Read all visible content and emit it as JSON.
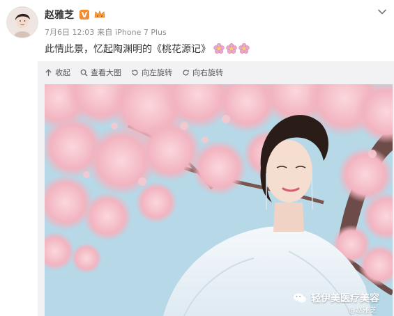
{
  "user": {
    "name": "赵雅芝",
    "verified_mark": "V"
  },
  "meta": {
    "date": "7月6日 12:03",
    "source_prefix": "来自",
    "device": "iPhone 7 Plus"
  },
  "post": {
    "text": "此情此景，忆起陶渊明的《桃花源记》",
    "emoji": [
      "flower",
      "flower",
      "flower"
    ]
  },
  "toolbar": {
    "collapse": "收起",
    "view_large": "查看大图",
    "rotate_left": "向左旋转",
    "rotate_right": "向右旋转"
  },
  "watermark": {
    "brand": "轻伊美医疗美容",
    "handle": "@赵雅芝"
  },
  "colors": {
    "badge": "#f28a2e",
    "meta_text": "#8b8b8b",
    "media_bg": "#f2f2f5",
    "sky": "#b7d8e6",
    "blossom": "#f3b9c4"
  }
}
